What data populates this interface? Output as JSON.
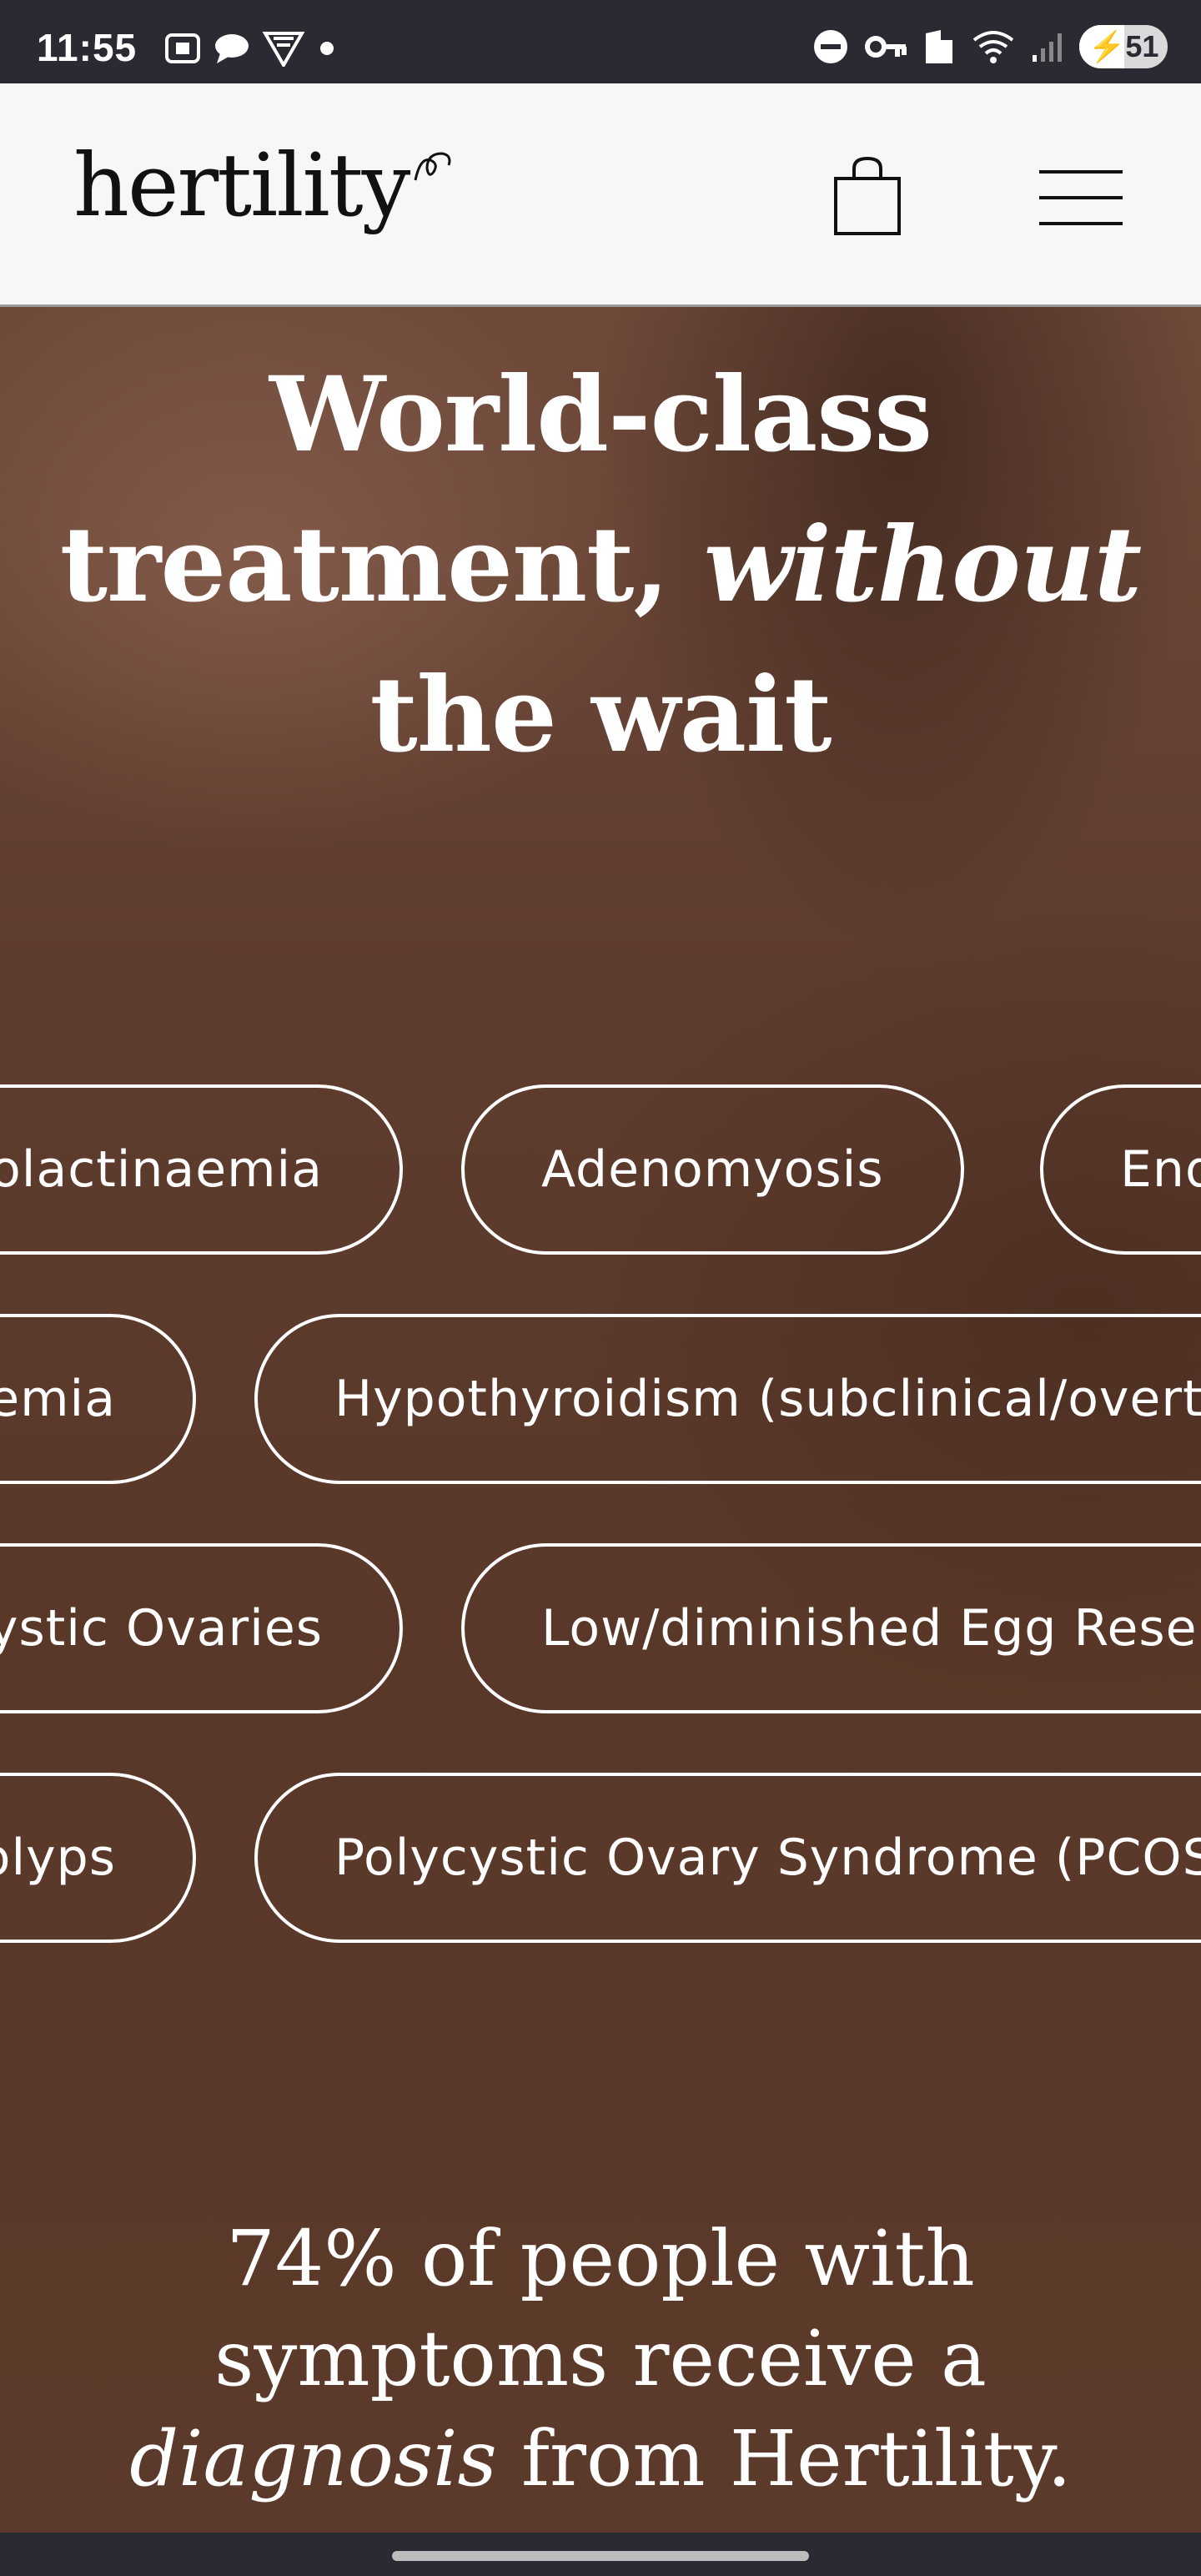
{
  "status_bar": {
    "time": "11:55",
    "battery": "51",
    "battery_level": 0.51
  },
  "header": {
    "logo": "hertility",
    "icons": [
      "shopping-bag-icon",
      "hamburger-menu-icon"
    ]
  },
  "hero": {
    "title_line1": "World-class",
    "title_line2_a": "treatment, ",
    "title_line2_italic": "without",
    "title_line3": "the wait",
    "conditions": [
      "Hyperprolactinaemia",
      "Adenomyosis",
      "Endometriosis",
      "Anaemia",
      "Hypothyroidism (subclinical/overt)",
      "Polycystic Ovaries",
      "Low/diminished Egg Reserve",
      "Polyps",
      "Polycystic Ovary Syndrome (PCOS)"
    ]
  },
  "stat": {
    "line1": "74% of people with",
    "line2": "symptoms receive a",
    "line3_italic": "diagnosis",
    "line3_rest": " from Hertility."
  },
  "colors": {
    "header_bg": "#f8f7f5",
    "system_bar_bg": "#2b2a33",
    "hero_text": "#ffffff"
  }
}
